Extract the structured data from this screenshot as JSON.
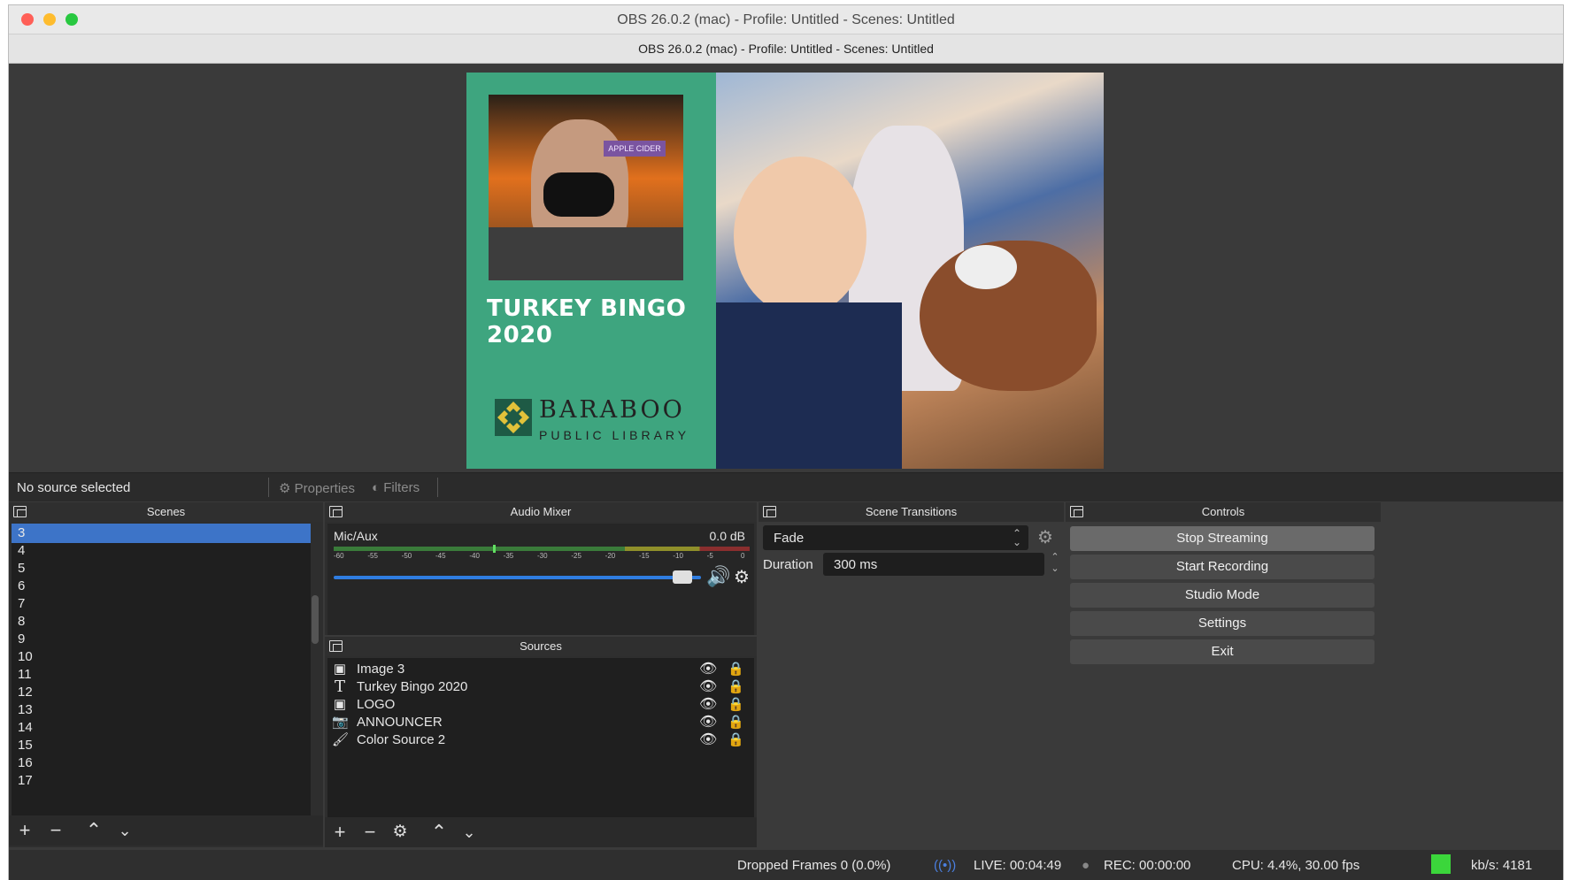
{
  "window": {
    "title": "OBS 26.0.2 (mac) - Profile: Untitled - Scenes: Untitled",
    "subtitle": "OBS 26.0.2 (mac) - Profile: Untitled - Scenes: Untitled",
    "traffic_lights": {
      "close": "#ff5f57",
      "minimize": "#febc2e",
      "maximize": "#28c840"
    }
  },
  "preview": {
    "poster_title": "TURKEY BINGO 2020",
    "photo_sign": "APPLE CIDER",
    "library_name": "BARABOO",
    "library_sub": "PUBLIC LIBRARY",
    "poster_bg": "#3ea57f"
  },
  "source_bar": {
    "no_source": "No source selected",
    "properties": "Properties",
    "filters": "Filters"
  },
  "scenes": {
    "title": "Scenes",
    "items": [
      "3",
      "4",
      "5",
      "6",
      "7",
      "8",
      "9",
      "10",
      "11",
      "12",
      "13",
      "14",
      "15",
      "16",
      "17"
    ],
    "selected": "3"
  },
  "audio_mixer": {
    "title": "Audio Mixer",
    "channel": "Mic/Aux",
    "level": "0.0 dB",
    "ticks": [
      "-60",
      "-55",
      "-50",
      "-45",
      "-40",
      "-35",
      "-30",
      "-25",
      "-20",
      "-15",
      "-10",
      "-5",
      "0"
    ],
    "volume_fraction": 0.95
  },
  "sources": {
    "title": "Sources",
    "items": [
      {
        "name": "Image 3",
        "icon": "image-icon"
      },
      {
        "name": "Turkey Bingo 2020",
        "icon": "text-icon"
      },
      {
        "name": "LOGO",
        "icon": "image-icon"
      },
      {
        "name": "ANNOUNCER",
        "icon": "camera-icon"
      },
      {
        "name": "Color Source 2",
        "icon": "brush-icon"
      }
    ]
  },
  "scene_transitions": {
    "title": "Scene Transitions",
    "transition": "Fade",
    "duration_label": "Duration",
    "duration_value": "300 ms"
  },
  "controls": {
    "title": "Controls",
    "stop_streaming": "Stop Streaming",
    "start_recording": "Start Recording",
    "studio_mode": "Studio Mode",
    "settings": "Settings",
    "exit": "Exit"
  },
  "status": {
    "dropped_frames": "Dropped Frames 0 (0.0%)",
    "live": "LIVE: 00:04:49",
    "rec": "REC: 00:00:00",
    "cpu": "CPU: 4.4%, 30.00 fps",
    "kbps": "kb/s: 4181",
    "health_color": "#3bd63b"
  }
}
